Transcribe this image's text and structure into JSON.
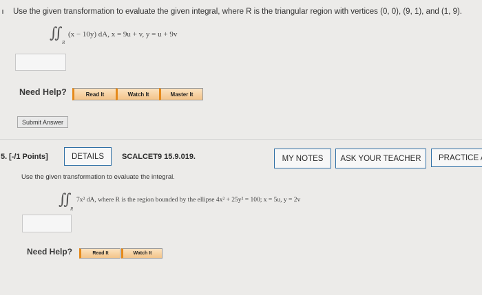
{
  "question1": {
    "instruction": "Use the given transformation to evaluate the given integral, where R is the triangular region with vertices (0, 0), (9, 1), and (1, 9).",
    "integral_symbol": "∬",
    "integral_sub": "R",
    "integrand": "(x − 10y) dA,   x = 9u + v,   y = u + 9v",
    "answer_value": "",
    "need_help_label": "Need Help?",
    "help_buttons": [
      "Read It",
      "Watch It",
      "Master It"
    ],
    "submit_label": "Submit Answer"
  },
  "question2": {
    "number": "5.",
    "points": "[-/1 Points]",
    "details_label": "DETAILS",
    "code": "SCALCET9 15.9.019.",
    "my_notes_label": "MY NOTES",
    "ask_teacher_label": "ASK YOUR TEACHER",
    "practice_label": "PRACTICE A",
    "instruction": "Use the given transformation to evaluate the integral.",
    "integral_symbol": "∬",
    "integral_sub": "R",
    "integrand": "7x² dA, where R is the region bounded by the ellipse 4x² + 25y² = 100; x = 5u, y = 2v",
    "answer_value": "",
    "need_help_label": "Need Help?",
    "help_buttons": [
      "Read It",
      "Watch It"
    ]
  },
  "colors": {
    "page_bg": "#ecebe9",
    "accent_blue": "#2f6fa5",
    "help_orange": "#e58a1b"
  }
}
